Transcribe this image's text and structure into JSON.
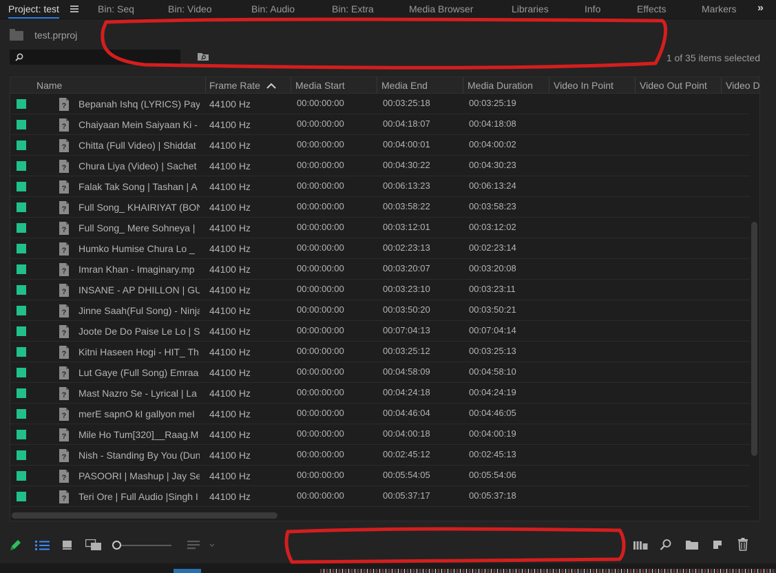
{
  "tabs": [
    {
      "label": "Project: test",
      "active": true
    },
    {
      "label": "Bin: Seq"
    },
    {
      "label": "Bin: Video"
    },
    {
      "label": "Bin: Audio"
    },
    {
      "label": "Bin: Extra"
    },
    {
      "label": "Media Browser"
    },
    {
      "label": "Libraries"
    },
    {
      "label": "Info"
    },
    {
      "label": "Effects"
    },
    {
      "label": "Markers"
    }
  ],
  "project": {
    "file_name": "test.prproj"
  },
  "search": {
    "value": "",
    "placeholder": ""
  },
  "selection_status": "1 of 35 items selected",
  "columns": [
    "Name",
    "Frame Rate",
    "Media Start",
    "Media End",
    "Media Duration",
    "Video In Point",
    "Video Out Point",
    "Video D"
  ],
  "sort": {
    "column": "Frame Rate",
    "direction": "ascending"
  },
  "rows": [
    {
      "name": "Bepanah Ishq (LYRICS) Pay",
      "frame_rate": "44100 Hz",
      "media_start": "00:00:00:00",
      "media_end": "00:03:25:18",
      "media_duration": "00:03:25:19"
    },
    {
      "name": "Chaiyaan Mein Saiyaan Ki -",
      "frame_rate": "44100 Hz",
      "media_start": "00:00:00:00",
      "media_end": "00:04:18:07",
      "media_duration": "00:04:18:08"
    },
    {
      "name": "Chitta (Full Video) | Shiddat",
      "frame_rate": "44100 Hz",
      "media_start": "00:00:00:00",
      "media_end": "00:04:00:01",
      "media_duration": "00:04:00:02"
    },
    {
      "name": "Chura Liya (Video) | Sachet",
      "frame_rate": "44100 Hz",
      "media_start": "00:00:00:00",
      "media_end": "00:04:30:22",
      "media_duration": "00:04:30:23"
    },
    {
      "name": "Falak Tak Song | Tashan | A",
      "frame_rate": "44100 Hz",
      "media_start": "00:00:00:00",
      "media_end": "00:06:13:23",
      "media_duration": "00:06:13:24"
    },
    {
      "name": "Full Song_ KHAIRIYAT (BON",
      "frame_rate": "44100 Hz",
      "media_start": "00:00:00:00",
      "media_end": "00:03:58:22",
      "media_duration": "00:03:58:23"
    },
    {
      "name": "Full Song_ Mere Sohneya |",
      "frame_rate": "44100 Hz",
      "media_start": "00:00:00:00",
      "media_end": "00:03:12:01",
      "media_duration": "00:03:12:02"
    },
    {
      "name": "Humko Humise Chura Lo _",
      "frame_rate": "44100 Hz",
      "media_start": "00:00:00:00",
      "media_end": "00:02:23:13",
      "media_duration": "00:02:23:14"
    },
    {
      "name": "Imran Khan - Imaginary.mp",
      "frame_rate": "44100 Hz",
      "media_start": "00:00:00:00",
      "media_end": "00:03:20:07",
      "media_duration": "00:03:20:08"
    },
    {
      "name": "INSANE - AP DHILLON | GU",
      "frame_rate": "44100 Hz",
      "media_start": "00:00:00:00",
      "media_end": "00:03:23:10",
      "media_duration": "00:03:23:11"
    },
    {
      "name": "Jinne Saah(Ful Song) - Ninja",
      "frame_rate": "44100 Hz",
      "media_start": "00:00:00:00",
      "media_end": "00:03:50:20",
      "media_duration": "00:03:50:21"
    },
    {
      "name": "Joote De Do Paise Le Lo | S",
      "frame_rate": "44100 Hz",
      "media_start": "00:00:00:00",
      "media_end": "00:07:04:13",
      "media_duration": "00:07:04:14"
    },
    {
      "name": "Kitni Haseen Hogi - HIT_ Th",
      "frame_rate": "44100 Hz",
      "media_start": "00:00:00:00",
      "media_end": "00:03:25:12",
      "media_duration": "00:03:25:13"
    },
    {
      "name": "Lut Gaye (Full Song) Emraa",
      "frame_rate": "44100 Hz",
      "media_start": "00:00:00:00",
      "media_end": "00:04:58:09",
      "media_duration": "00:04:58:10"
    },
    {
      "name": "Mast Nazro Se - Lyrical | La",
      "frame_rate": "44100 Hz",
      "media_start": "00:00:00:00",
      "media_end": "00:04:24:18",
      "media_duration": "00:04:24:19"
    },
    {
      "name": "merE sapnO kI gallyon meI",
      "frame_rate": "44100 Hz",
      "media_start": "00:00:00:00",
      "media_end": "00:04:46:04",
      "media_duration": "00:04:46:05"
    },
    {
      "name": "Mile Ho Tum[320]__Raag.M",
      "frame_rate": "44100 Hz",
      "media_start": "00:00:00:00",
      "media_end": "00:04:00:18",
      "media_duration": "00:04:00:19"
    },
    {
      "name": "Nish - Standing By You (Dun",
      "frame_rate": "44100 Hz",
      "media_start": "00:00:00:00",
      "media_end": "00:02:45:12",
      "media_duration": "00:02:45:13"
    },
    {
      "name": "PASOORI | Mashup | Jay Se",
      "frame_rate": "44100 Hz",
      "media_start": "00:00:00:00",
      "media_end": "00:05:54:05",
      "media_duration": "00:05:54:06"
    },
    {
      "name": "Teri Ore | Full Audio |Singh I",
      "frame_rate": "44100 Hz",
      "media_start": "00:00:00:00",
      "media_end": "00:05:37:17",
      "media_duration": "00:05:37:18"
    }
  ],
  "colors": {
    "label_green": "#21c08b",
    "accent_blue": "#2c7fe8",
    "annotation_red": "#d41e1e"
  },
  "icons": {
    "toolbar": [
      "pencil-icon",
      "list-view-icon",
      "icon-view-icon",
      "freeform-view-icon",
      "zoom-slider",
      "sort-icons-icon",
      "automate-to-sequence-icon",
      "find-icon",
      "new-bin-icon",
      "new-item-icon",
      "clear-icon"
    ]
  },
  "zoom_level": 0.0
}
